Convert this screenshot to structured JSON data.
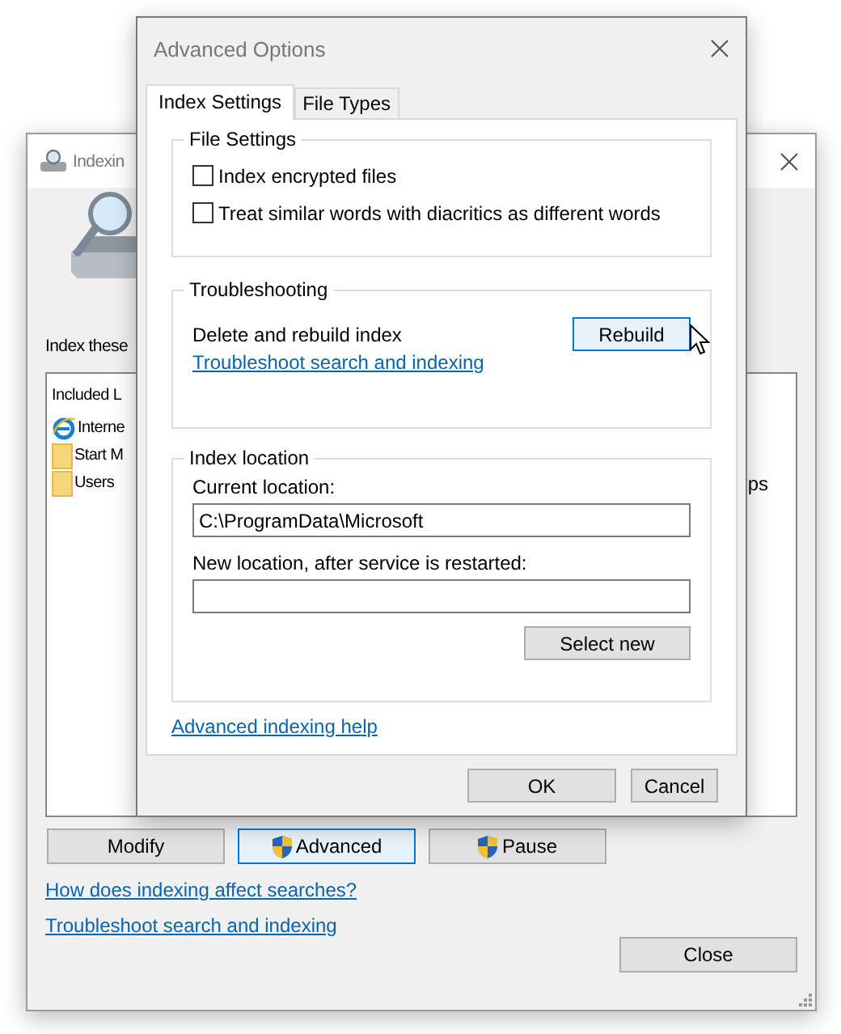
{
  "back_window": {
    "title": "Indexin",
    "heading": "Index these",
    "list": {
      "column_1": "Included L",
      "rows": [
        {
          "kind": "browser",
          "name": "Interne"
        },
        {
          "kind": "folder",
          "name": "Start M"
        },
        {
          "kind": "folder",
          "name": "Users",
          "column_2": "ps"
        }
      ]
    },
    "buttons": [
      {
        "label": "Modify",
        "shield": false,
        "focused": false
      },
      {
        "label": "Advanced",
        "shield": true,
        "focused": true
      },
      {
        "label": "Pause",
        "shield": true,
        "focused": false
      }
    ],
    "links": [
      "How does indexing affect searches?",
      "Troubleshoot search and indexing"
    ],
    "close_button": "Close"
  },
  "dialog": {
    "title": "Advanced Options",
    "tabs": [
      {
        "label": "Index Settings",
        "selected": true
      },
      {
        "label": "File Types",
        "selected": false
      }
    ],
    "file_settings": {
      "title": "File Settings",
      "options": [
        {
          "label": "Index encrypted files",
          "checked": false
        },
        {
          "label": "Treat similar words with diacritics as different words",
          "checked": false
        }
      ]
    },
    "troubleshooting": {
      "title": "Troubleshooting",
      "text": "Delete and rebuild index",
      "button": {
        "label": "Rebuild",
        "hovered": true
      },
      "link": "Troubleshoot search and indexing"
    },
    "index_location": {
      "title": "Index location",
      "current_label": "Current location:",
      "current_value": "C:\\ProgramData\\Microsoft",
      "new_label": "New location, after service is restarted:",
      "button": "Select new"
    },
    "help_link": "Advanced indexing help",
    "buttons": [
      "OK",
      "Cancel"
    ]
  }
}
